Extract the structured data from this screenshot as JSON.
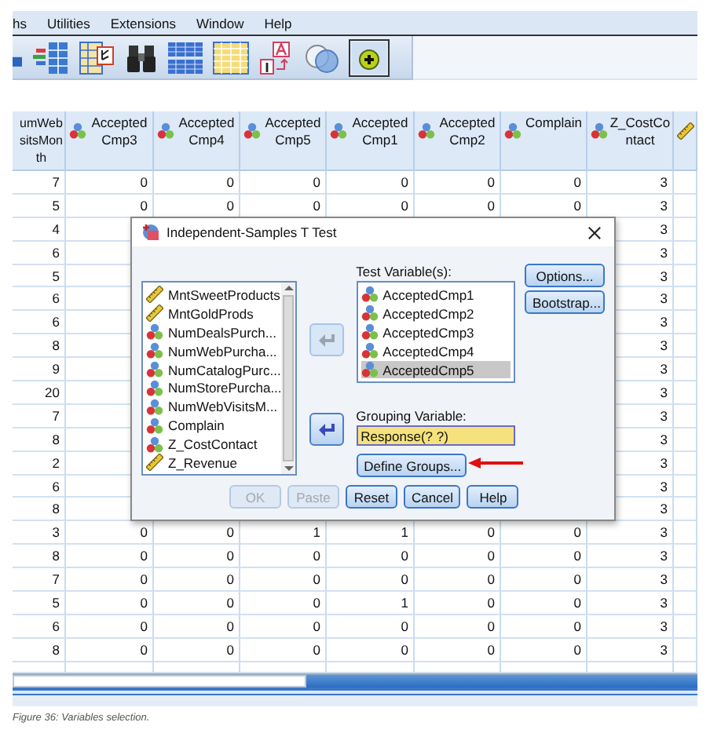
{
  "menu_bar": {
    "items": [
      "hs",
      "Utilities",
      "Extensions",
      "Window",
      "Help"
    ]
  },
  "table": {
    "columns": [
      {
        "lines": [
          "umWeb",
          "sitsMon",
          "th"
        ],
        "kind": "none"
      },
      {
        "lines": [
          "Accepted",
          "Cmp3"
        ],
        "kind": "nominal"
      },
      {
        "lines": [
          "Accepted",
          "Cmp4"
        ],
        "kind": "nominal"
      },
      {
        "lines": [
          "Accepted",
          "Cmp5"
        ],
        "kind": "nominal"
      },
      {
        "lines": [
          "Accepted",
          "Cmp1"
        ],
        "kind": "nominal"
      },
      {
        "lines": [
          "Accepted",
          "Cmp2"
        ],
        "kind": "nominal"
      },
      {
        "lines": [
          "Complain"
        ],
        "kind": "nominal"
      },
      {
        "lines": [
          "Z_CostCo",
          "ntact"
        ],
        "kind": "nominal"
      },
      {
        "kind": "scale"
      }
    ],
    "rows": [
      {
        "cells": [
          "7",
          "0",
          "0",
          "0",
          "0",
          "0",
          "0",
          "3"
        ]
      },
      {
        "cells": [
          "5",
          "0",
          "0",
          "0",
          "0",
          "0",
          "0",
          "3"
        ]
      },
      {
        "cells": [
          "4",
          null,
          null,
          null,
          null,
          null,
          null,
          "3"
        ]
      },
      {
        "cells": [
          "6",
          null,
          null,
          null,
          null,
          null,
          null,
          "3"
        ]
      },
      {
        "cells": [
          "5",
          null,
          null,
          null,
          null,
          null,
          null,
          "3"
        ]
      },
      {
        "cells": [
          "6",
          null,
          null,
          null,
          null,
          null,
          null,
          "3"
        ]
      },
      {
        "cells": [
          "6",
          null,
          null,
          null,
          null,
          null,
          null,
          "3"
        ]
      },
      {
        "cells": [
          "8",
          null,
          null,
          null,
          null,
          null,
          null,
          "3"
        ]
      },
      {
        "cells": [
          "9",
          null,
          null,
          null,
          null,
          null,
          null,
          "3"
        ]
      },
      {
        "cells": [
          "20",
          null,
          null,
          null,
          null,
          null,
          null,
          "3"
        ]
      },
      {
        "cells": [
          "7",
          null,
          null,
          null,
          null,
          null,
          null,
          "3"
        ]
      },
      {
        "cells": [
          "8",
          null,
          null,
          null,
          null,
          null,
          null,
          "3"
        ]
      },
      {
        "cells": [
          "2",
          null,
          null,
          null,
          null,
          null,
          null,
          "3"
        ]
      },
      {
        "cells": [
          "6",
          null,
          null,
          null,
          null,
          null,
          null,
          "3"
        ]
      },
      {
        "cells": [
          "8",
          null,
          null,
          null,
          null,
          null,
          null,
          "3"
        ]
      },
      {
        "cells": [
          "3",
          "0",
          "0",
          "1",
          "1",
          "0",
          "0",
          "3"
        ]
      },
      {
        "cells": [
          "8",
          "0",
          "0",
          "0",
          "0",
          "0",
          "0",
          "3"
        ]
      },
      {
        "cells": [
          "7",
          "0",
          "0",
          "0",
          "0",
          "0",
          "0",
          "3"
        ]
      },
      {
        "cells": [
          "5",
          "0",
          "0",
          "0",
          "1",
          "0",
          "0",
          "3"
        ]
      },
      {
        "cells": [
          "6",
          "0",
          "0",
          "0",
          "0",
          "0",
          "0",
          "3"
        ]
      },
      {
        "cells": [
          "8",
          "0",
          "0",
          "0",
          "0",
          "0",
          "0",
          "3"
        ]
      }
    ]
  },
  "dialog": {
    "title": "Independent-Samples T Test",
    "source_list": {
      "items": [
        {
          "label": "MntSweetProducts",
          "kind": "scale"
        },
        {
          "label": "MntGoldProds",
          "kind": "scale"
        },
        {
          "label": "NumDealsPurch...",
          "kind": "nominal"
        },
        {
          "label": "NumWebPurcha...",
          "kind": "nominal"
        },
        {
          "label": "NumCatalogPurc...",
          "kind": "nominal"
        },
        {
          "label": "NumStorePurcha...",
          "kind": "nominal"
        },
        {
          "label": "NumWebVisitsM...",
          "kind": "nominal"
        },
        {
          "label": "Complain",
          "kind": "nominal"
        },
        {
          "label": "Z_CostContact",
          "kind": "nominal"
        },
        {
          "label": "Z_Revenue",
          "kind": "scale"
        }
      ]
    },
    "move_buttons": [
      {
        "disabled": true
      },
      {
        "disabled": false
      }
    ],
    "test_variables": {
      "label": "Test Variable(s):",
      "items": [
        {
          "label": "AcceptedCmp1",
          "kind": "nominal",
          "selected": false
        },
        {
          "label": "AcceptedCmp2",
          "kind": "nominal",
          "selected": false
        },
        {
          "label": "AcceptedCmp3",
          "kind": "nominal",
          "selected": false
        },
        {
          "label": "AcceptedCmp4",
          "kind": "nominal",
          "selected": false
        },
        {
          "label": "AcceptedCmp5",
          "kind": "nominal",
          "selected": true
        }
      ]
    },
    "grouping_variable": {
      "label": "Grouping Variable:",
      "value": "Response(? ?)"
    },
    "define_button": {
      "label": "Define Groups...",
      "disabled": false
    },
    "side_buttons": [
      {
        "label": "Options...",
        "disabled": false
      },
      {
        "label": "Bootstrap...",
        "disabled": false
      }
    ],
    "bottom_buttons": [
      {
        "label": "OK",
        "disabled": true
      },
      {
        "label": "Paste",
        "disabled": true
      },
      {
        "label": "Reset",
        "disabled": false
      },
      {
        "label": "Cancel",
        "disabled": false
      },
      {
        "label": "Help",
        "disabled": false
      }
    ]
  },
  "caption": "Figure 36: Variables selection."
}
